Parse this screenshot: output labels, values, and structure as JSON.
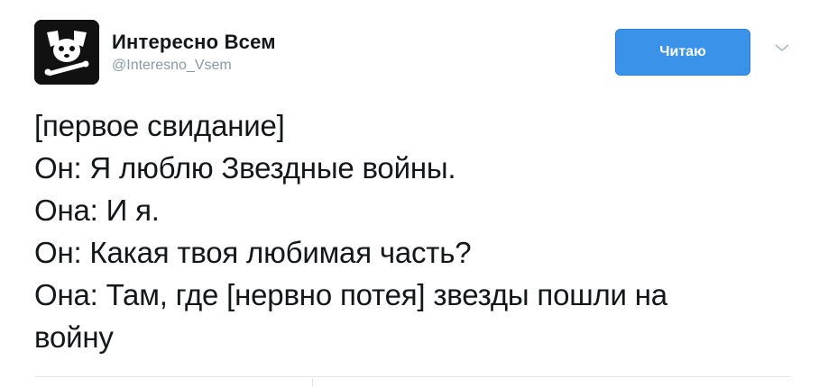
{
  "header": {
    "display_name": "Интересно Всем",
    "handle": "@Interesno_Vsem",
    "follow_label": "Читаю",
    "avatar_icon": "dog-skull-logo-icon",
    "menu_icon": "chevron-down-icon"
  },
  "tweet": {
    "lines": [
      "[первое свидание]",
      "Он: Я люблю Звездные войны.",
      "Она: И я.",
      "Он: Какая твоя любимая часть?",
      "Она: Там, где [нервно потея] звезды пошли на",
      "войну"
    ]
  },
  "colors": {
    "accent": "#3a93e8",
    "handle": "#8899a6",
    "divider": "#e1e8ed",
    "text": "#14171a"
  }
}
